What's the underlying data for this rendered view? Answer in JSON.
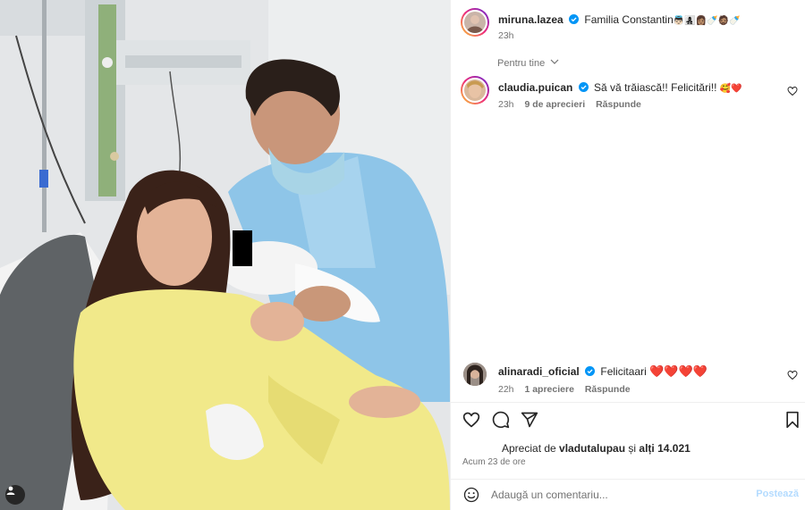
{
  "post": {
    "author": "miruna.lazea",
    "caption": "Familia Constantin",
    "caption_emojis": "👼🏻👩‍👧‍👦👩🏽🍼🧔🏽🍼",
    "time": "23h"
  },
  "sort_label": "Pentru tine",
  "comments": [
    {
      "author": "claudia.puican",
      "text": "Să vă trăiască!! Felicitări!!",
      "emojis": "🥰❤️",
      "time": "23h",
      "likes": "9 de aprecieri",
      "reply": "Răspunde"
    },
    {
      "author": "alinaradi_oficial",
      "text": "Felicitaari",
      "emojis": "❤️❤️❤️❤️",
      "time": "22h",
      "likes": "1 apreciere",
      "reply": "Răspunde"
    }
  ],
  "likes_summary": {
    "prefix": "Apreciat de",
    "user": "vladutalupau",
    "middle": "și",
    "others": "alți 14.021"
  },
  "time_ago": "Acum 23 de ore",
  "add_comment": {
    "placeholder": "Adaugă un comentariu...",
    "post_label": "Postează"
  },
  "icons": {
    "like": "heart-icon",
    "comment": "comment-icon",
    "share": "share-icon",
    "save": "bookmark-icon",
    "emoji": "emoji-icon",
    "tags": "user-tag-icon"
  },
  "colors": {
    "verified": "#0095f6",
    "heart": "#ed4956",
    "post_button": "#b3dbff",
    "muted": "#737373"
  }
}
